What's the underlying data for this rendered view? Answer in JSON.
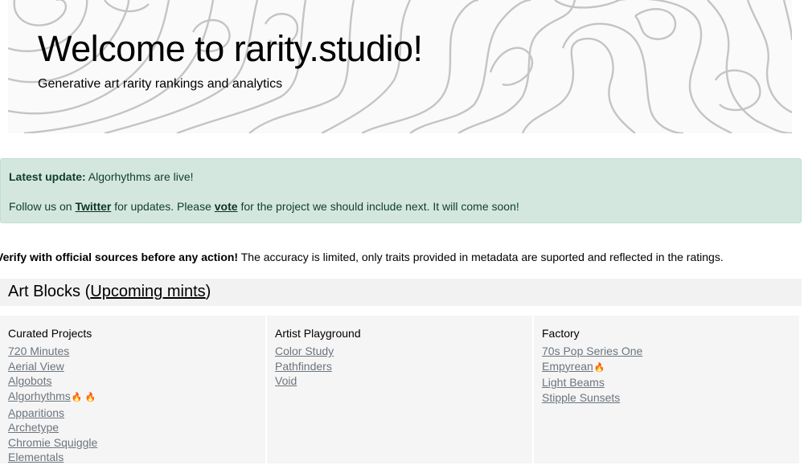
{
  "hero": {
    "title_prefix": "Welcome to ",
    "title_brand": "rarity.studio",
    "title_suffix": "!",
    "subtitle": "Generative art rarity rankings and analytics"
  },
  "alert": {
    "latest_label": "Latest update:",
    "latest_text": " Algorhythms are live!",
    "follow_prefix": "Follow us on ",
    "twitter_link": "Twitter",
    "follow_mid": " for updates. Please ",
    "vote_link": "vote",
    "follow_suffix": " for the project we should include next. It will come soon!"
  },
  "warning": {
    "bold": "Verify with official sources before any action!",
    "text": " The accuracy is limited, only traits provided in metadata are suported and reflected in the ratings."
  },
  "section": {
    "title_prefix": "Art Blocks (",
    "upcoming_link": "Upcoming mints",
    "title_suffix": ")"
  },
  "columns": [
    {
      "title": "Curated Projects",
      "items": [
        {
          "label": "720 Minutes",
          "fire": ""
        },
        {
          "label": "Aerial View",
          "fire": ""
        },
        {
          "label": "Algobots",
          "fire": ""
        },
        {
          "label": "Algorhythms",
          "fire": "🔥 🔥"
        },
        {
          "label": "Apparitions",
          "fire": ""
        },
        {
          "label": "Archetype",
          "fire": ""
        },
        {
          "label": "Chromie Squiggle",
          "fire": ""
        },
        {
          "label": "Elementals",
          "fire": ""
        }
      ]
    },
    {
      "title": "Artist Playground",
      "items": [
        {
          "label": "Color Study",
          "fire": ""
        },
        {
          "label": "Pathfinders",
          "fire": ""
        },
        {
          "label": "Void",
          "fire": ""
        }
      ]
    },
    {
      "title": "Factory",
      "items": [
        {
          "label": "70s Pop Series One",
          "fire": ""
        },
        {
          "label": "Empyrean",
          "fire": "🔥"
        },
        {
          "label": "Light Beams",
          "fire": ""
        },
        {
          "label": "Stipple Sunsets",
          "fire": ""
        }
      ]
    }
  ]
}
